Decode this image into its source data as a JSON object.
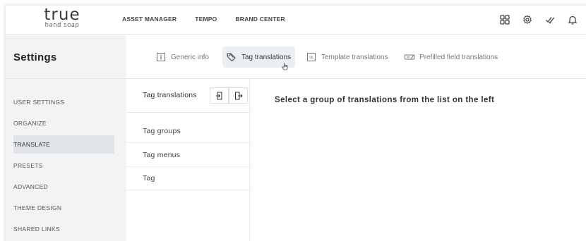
{
  "brand": {
    "name": "true",
    "tagline": "hand soap"
  },
  "topnav": [
    "ASSET MANAGER",
    "TEMPO",
    "BRAND CENTER"
  ],
  "top_icons": [
    "grid-icon",
    "gear-icon",
    "check-icon",
    "bell-icon"
  ],
  "settings": {
    "title": "Settings"
  },
  "sidebar": {
    "items": [
      {
        "label": "USER SETTINGS",
        "active": false
      },
      {
        "label": "ORGANIZE",
        "active": false
      },
      {
        "label": "TRANSLATE",
        "active": true
      },
      {
        "label": "PRESETS",
        "active": false
      },
      {
        "label": "ADVANCED",
        "active": false
      },
      {
        "label": "THEME DESIGN",
        "active": false
      },
      {
        "label": "SHARED LINKS",
        "active": false
      }
    ]
  },
  "tabs": [
    {
      "label": "Generic info",
      "icon": "info-icon",
      "active": false
    },
    {
      "label": "Tag translations",
      "icon": "tag-icon",
      "active": true
    },
    {
      "label": "Template translations",
      "icon": "template-icon",
      "active": false
    },
    {
      "label": "Prefilled field translations",
      "icon": "field-icon",
      "active": false
    }
  ],
  "list": {
    "header": "Tag translations",
    "rows": [
      "Tag groups",
      "Tag menus",
      "Tag"
    ]
  },
  "main": {
    "message": "Select a group of translations from the list on the left"
  },
  "colors": {
    "active_bg": "#e1e4e9",
    "sidebar_bg": "#f3f3f3",
    "tab_active_bg": "#eceff2"
  }
}
